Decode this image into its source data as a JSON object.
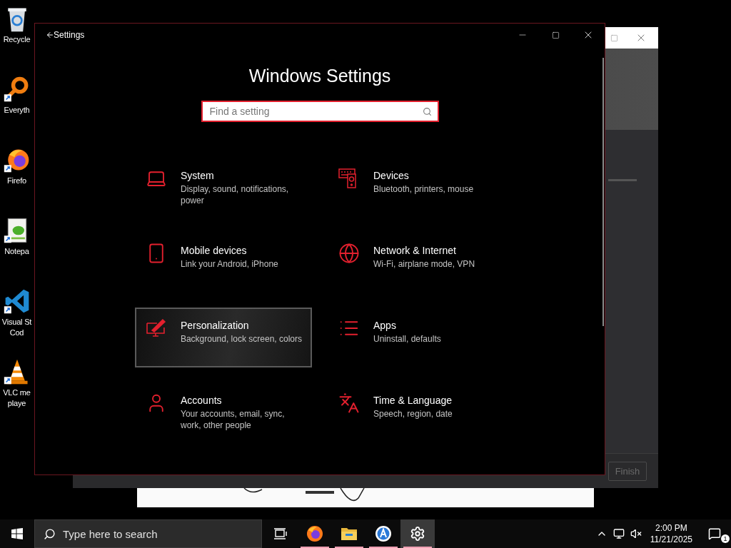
{
  "desktop_icons": [
    {
      "kind": "recycle-bin",
      "lines": [
        "Recycle"
      ]
    },
    {
      "kind": "search-tool",
      "lines": [
        "Everyth"
      ]
    },
    {
      "kind": "browser",
      "lines": [
        "Firefo"
      ]
    },
    {
      "kind": "notepad",
      "lines": [
        "Notepa"
      ]
    },
    {
      "kind": "code-editor",
      "lines": [
        "Visual St",
        "Cod"
      ]
    },
    {
      "kind": "media-player",
      "lines": [
        "VLC me",
        "playe"
      ]
    }
  ],
  "background_window": {
    "finish_button": {
      "label": "Finish",
      "disabled": true
    }
  },
  "settings_window": {
    "title": "Settings",
    "heading": "Windows Settings",
    "search": {
      "placeholder": "Find a setting"
    },
    "categories": [
      {
        "kind": "system",
        "name": "System",
        "description_lines": [
          "Display, sound, notifications,",
          "power"
        ],
        "selected": false
      },
      {
        "kind": "devices",
        "name": "Devices",
        "description_lines": [
          "Bluetooth, printers, mouse"
        ],
        "selected": false
      },
      {
        "kind": "mobile",
        "name": "Mobile devices",
        "description_lines": [
          "Link your Android, iPhone"
        ],
        "selected": false
      },
      {
        "kind": "network",
        "name": "Network & Internet",
        "description_lines": [
          "Wi-Fi, airplane mode, VPN"
        ],
        "selected": false
      },
      {
        "kind": "personalization",
        "name": "Personalization",
        "description_lines": [
          "Background, lock screen, colors"
        ],
        "selected": true
      },
      {
        "kind": "apps",
        "name": "Apps",
        "description_lines": [
          "Uninstall, defaults"
        ],
        "selected": false
      },
      {
        "kind": "accounts",
        "name": "Accounts",
        "description_lines": [
          "Your accounts, email, sync,",
          "work, other people"
        ],
        "selected": false
      },
      {
        "kind": "time",
        "name": "Time & Language",
        "description_lines": [
          "Speech, region, date"
        ],
        "selected": false
      }
    ]
  },
  "taskbar": {
    "search": {
      "placeholder": "Type here to search"
    },
    "apps": [
      {
        "kind": "task-view",
        "running": false,
        "selected": false
      },
      {
        "kind": "browser",
        "running": true,
        "selected": false
      },
      {
        "kind": "folder",
        "running": true,
        "selected": false
      },
      {
        "kind": "store",
        "running": true,
        "selected": false
      },
      {
        "kind": "settings",
        "running": true,
        "selected": true
      }
    ],
    "clock": {
      "time": "2:00 PM",
      "date": "11/21/2025"
    },
    "notification_count": "1"
  }
}
